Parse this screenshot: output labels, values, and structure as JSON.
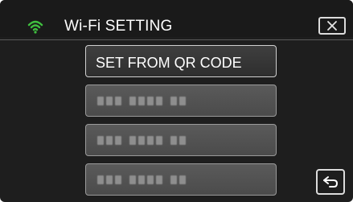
{
  "header": {
    "icon": "wifi-icon",
    "title": "Wi-Fi SETTING",
    "close_icon": "close-icon",
    "accent_color": "#3fbf3f"
  },
  "options": [
    {
      "label": "SET FROM QR CODE",
      "masked": false
    },
    {
      "label": "",
      "masked": true
    },
    {
      "label": "",
      "masked": true
    },
    {
      "label": "",
      "masked": true
    }
  ],
  "footer": {
    "back_icon": "return-arrow-icon"
  }
}
